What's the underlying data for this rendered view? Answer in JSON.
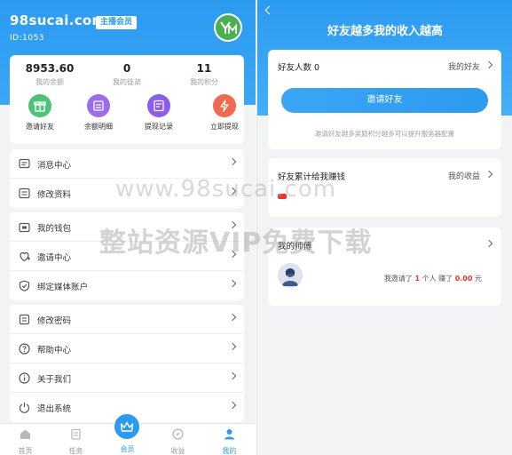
{
  "left": {
    "site_title": "98sucai.com",
    "vip_badge": "主播会员",
    "user_id": "ID:1053",
    "stats": [
      {
        "value": "8953.60",
        "label": "我的余额"
      },
      {
        "value": "0",
        "label": "我的徒弟"
      },
      {
        "value": "11",
        "label": "我的积分"
      }
    ],
    "quick_actions": [
      {
        "label": "邀请好友",
        "icon": "gift-icon",
        "color": "#4cc27a"
      },
      {
        "label": "余额明细",
        "icon": "list-icon",
        "color": "#9b6cf0"
      },
      {
        "label": "提现记录",
        "icon": "record-icon",
        "color": "#8a5cf0"
      },
      {
        "label": "立即提现",
        "icon": "bolt-icon",
        "color": "#f06a4d"
      }
    ],
    "menu_group_1": [
      {
        "label": "消息中心",
        "icon": "message-icon"
      },
      {
        "label": "修改资料",
        "icon": "edit-icon"
      }
    ],
    "menu_group_2": [
      {
        "label": "我的钱包",
        "icon": "wallet-icon"
      },
      {
        "label": "邀请中心",
        "icon": "invite-icon"
      },
      {
        "label": "绑定媒体账户",
        "icon": "shield-icon"
      }
    ],
    "menu_group_3": [
      {
        "label": "修改密码",
        "icon": "lock-icon"
      },
      {
        "label": "帮助中心",
        "icon": "help-icon"
      },
      {
        "label": "关于我们",
        "icon": "info-icon"
      },
      {
        "label": "退出系统",
        "icon": "logout-icon"
      }
    ],
    "tabs": [
      {
        "label": "首页",
        "icon": "home-icon"
      },
      {
        "label": "任务",
        "icon": "task-icon"
      },
      {
        "label": "会员",
        "icon": "crown-icon"
      },
      {
        "label": "收益",
        "icon": "compass-icon"
      },
      {
        "label": "我的",
        "icon": "user-icon"
      }
    ]
  },
  "right": {
    "title": "好友越多我的收入越高",
    "friends_count_label": "好友人数 0",
    "my_friends_link": "我的好友",
    "invite_button": "邀请好友",
    "invite_tip": "邀请好友越多奖励积分越多可以提升服务器配置",
    "earnings_label": "好友累计给我赚钱",
    "my_earnings_link": "我的收益",
    "mentor_label": "我的师傅",
    "invite_prefix": "我邀请了",
    "invite_count": "1",
    "invite_middle": "个人 赚了",
    "invite_amount": "0.00",
    "invite_suffix": "元"
  },
  "watermark": {
    "line1": "www.98sucai.com",
    "line2": "整站资源VIP免费下载"
  },
  "colors": {
    "primary": "#2b9bf0",
    "accent_red": "#e33333"
  }
}
